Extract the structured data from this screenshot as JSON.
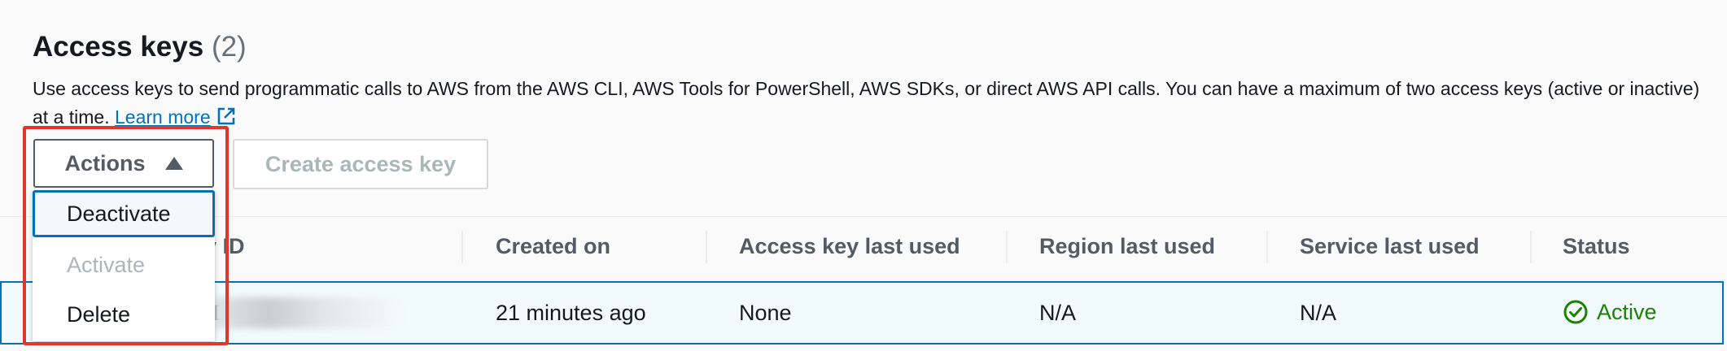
{
  "section": {
    "title": "Access keys",
    "count": "(2)",
    "description": "Use access keys to send programmatic calls to AWS from the AWS CLI, AWS Tools for PowerShell, AWS SDKs, or direct AWS API calls. You can have a maximum of two access keys (active or inactive) at a time.",
    "learn_more": "Learn more"
  },
  "toolbar": {
    "actions_label": "Actions",
    "create_label": "Create access key"
  },
  "actions_menu": {
    "items": [
      {
        "label": "Deactivate",
        "state": "focused"
      },
      {
        "label": "Activate",
        "state": "disabled"
      },
      {
        "label": "Delete",
        "state": "enabled"
      }
    ]
  },
  "table": {
    "columns": [
      "Access key ID",
      "Created on",
      "Access key last used",
      "Region last used",
      "Service last used",
      "Status"
    ],
    "visible_col0_fragment": "ey ID",
    "rows": [
      {
        "access_key_id_prefix": "D",
        "created_on": "21 minutes ago",
        "last_used": "None",
        "region": "N/A",
        "service": "N/A",
        "status": "Active"
      }
    ]
  },
  "colors": {
    "link": "#0073bb",
    "status_active": "#1d8102",
    "highlight_box": "#e53528"
  }
}
